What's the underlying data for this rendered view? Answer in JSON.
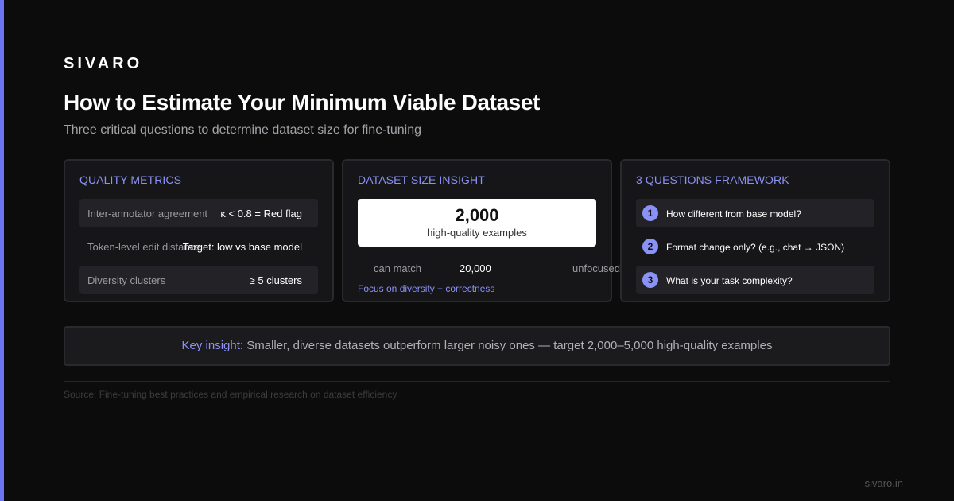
{
  "brand": "SIVARO",
  "title": "How to Estimate Your Minimum Viable Dataset",
  "subtitle": "Three critical questions to determine dataset size for fine-tuning",
  "colors": {
    "accent": "#6b74f2",
    "link": "#8b92f5",
    "background": "#0c0c0c",
    "card": "#161619"
  },
  "quality_metrics": {
    "heading": "QUALITY METRICS",
    "rows": [
      {
        "label": "Inter-annotator agreement",
        "value": "κ < 0.8 = Red flag"
      },
      {
        "label": "Token-level edit distance",
        "value": "Target: low vs base model"
      },
      {
        "label": "Diversity clusters",
        "value": "≥ 5 clusters"
      }
    ]
  },
  "dataset_insight": {
    "heading": "DATASET SIZE INSIGHT",
    "big_number": "2,000",
    "big_caption": "high-quality examples",
    "compare_label": "can match",
    "compare_number": "20,000",
    "compare_suffix": "unfocused",
    "focus_note": "Focus on diversity + correctness"
  },
  "framework": {
    "heading": "3 QUESTIONS FRAMEWORK",
    "questions": [
      {
        "num": "1",
        "text": "How different from base model?"
      },
      {
        "num": "2",
        "text": "Format change only? (e.g., chat → JSON)"
      },
      {
        "num": "3",
        "text": "What is your task complexity?"
      }
    ]
  },
  "key_insight": {
    "label": "Key insight:",
    "text": "Smaller, diverse datasets outperform larger noisy ones — target 2,000–5,000 high-quality examples"
  },
  "source": "Source: Fine-tuning best practices and empirical research on dataset efficiency",
  "footer_url": "sivaro.in"
}
